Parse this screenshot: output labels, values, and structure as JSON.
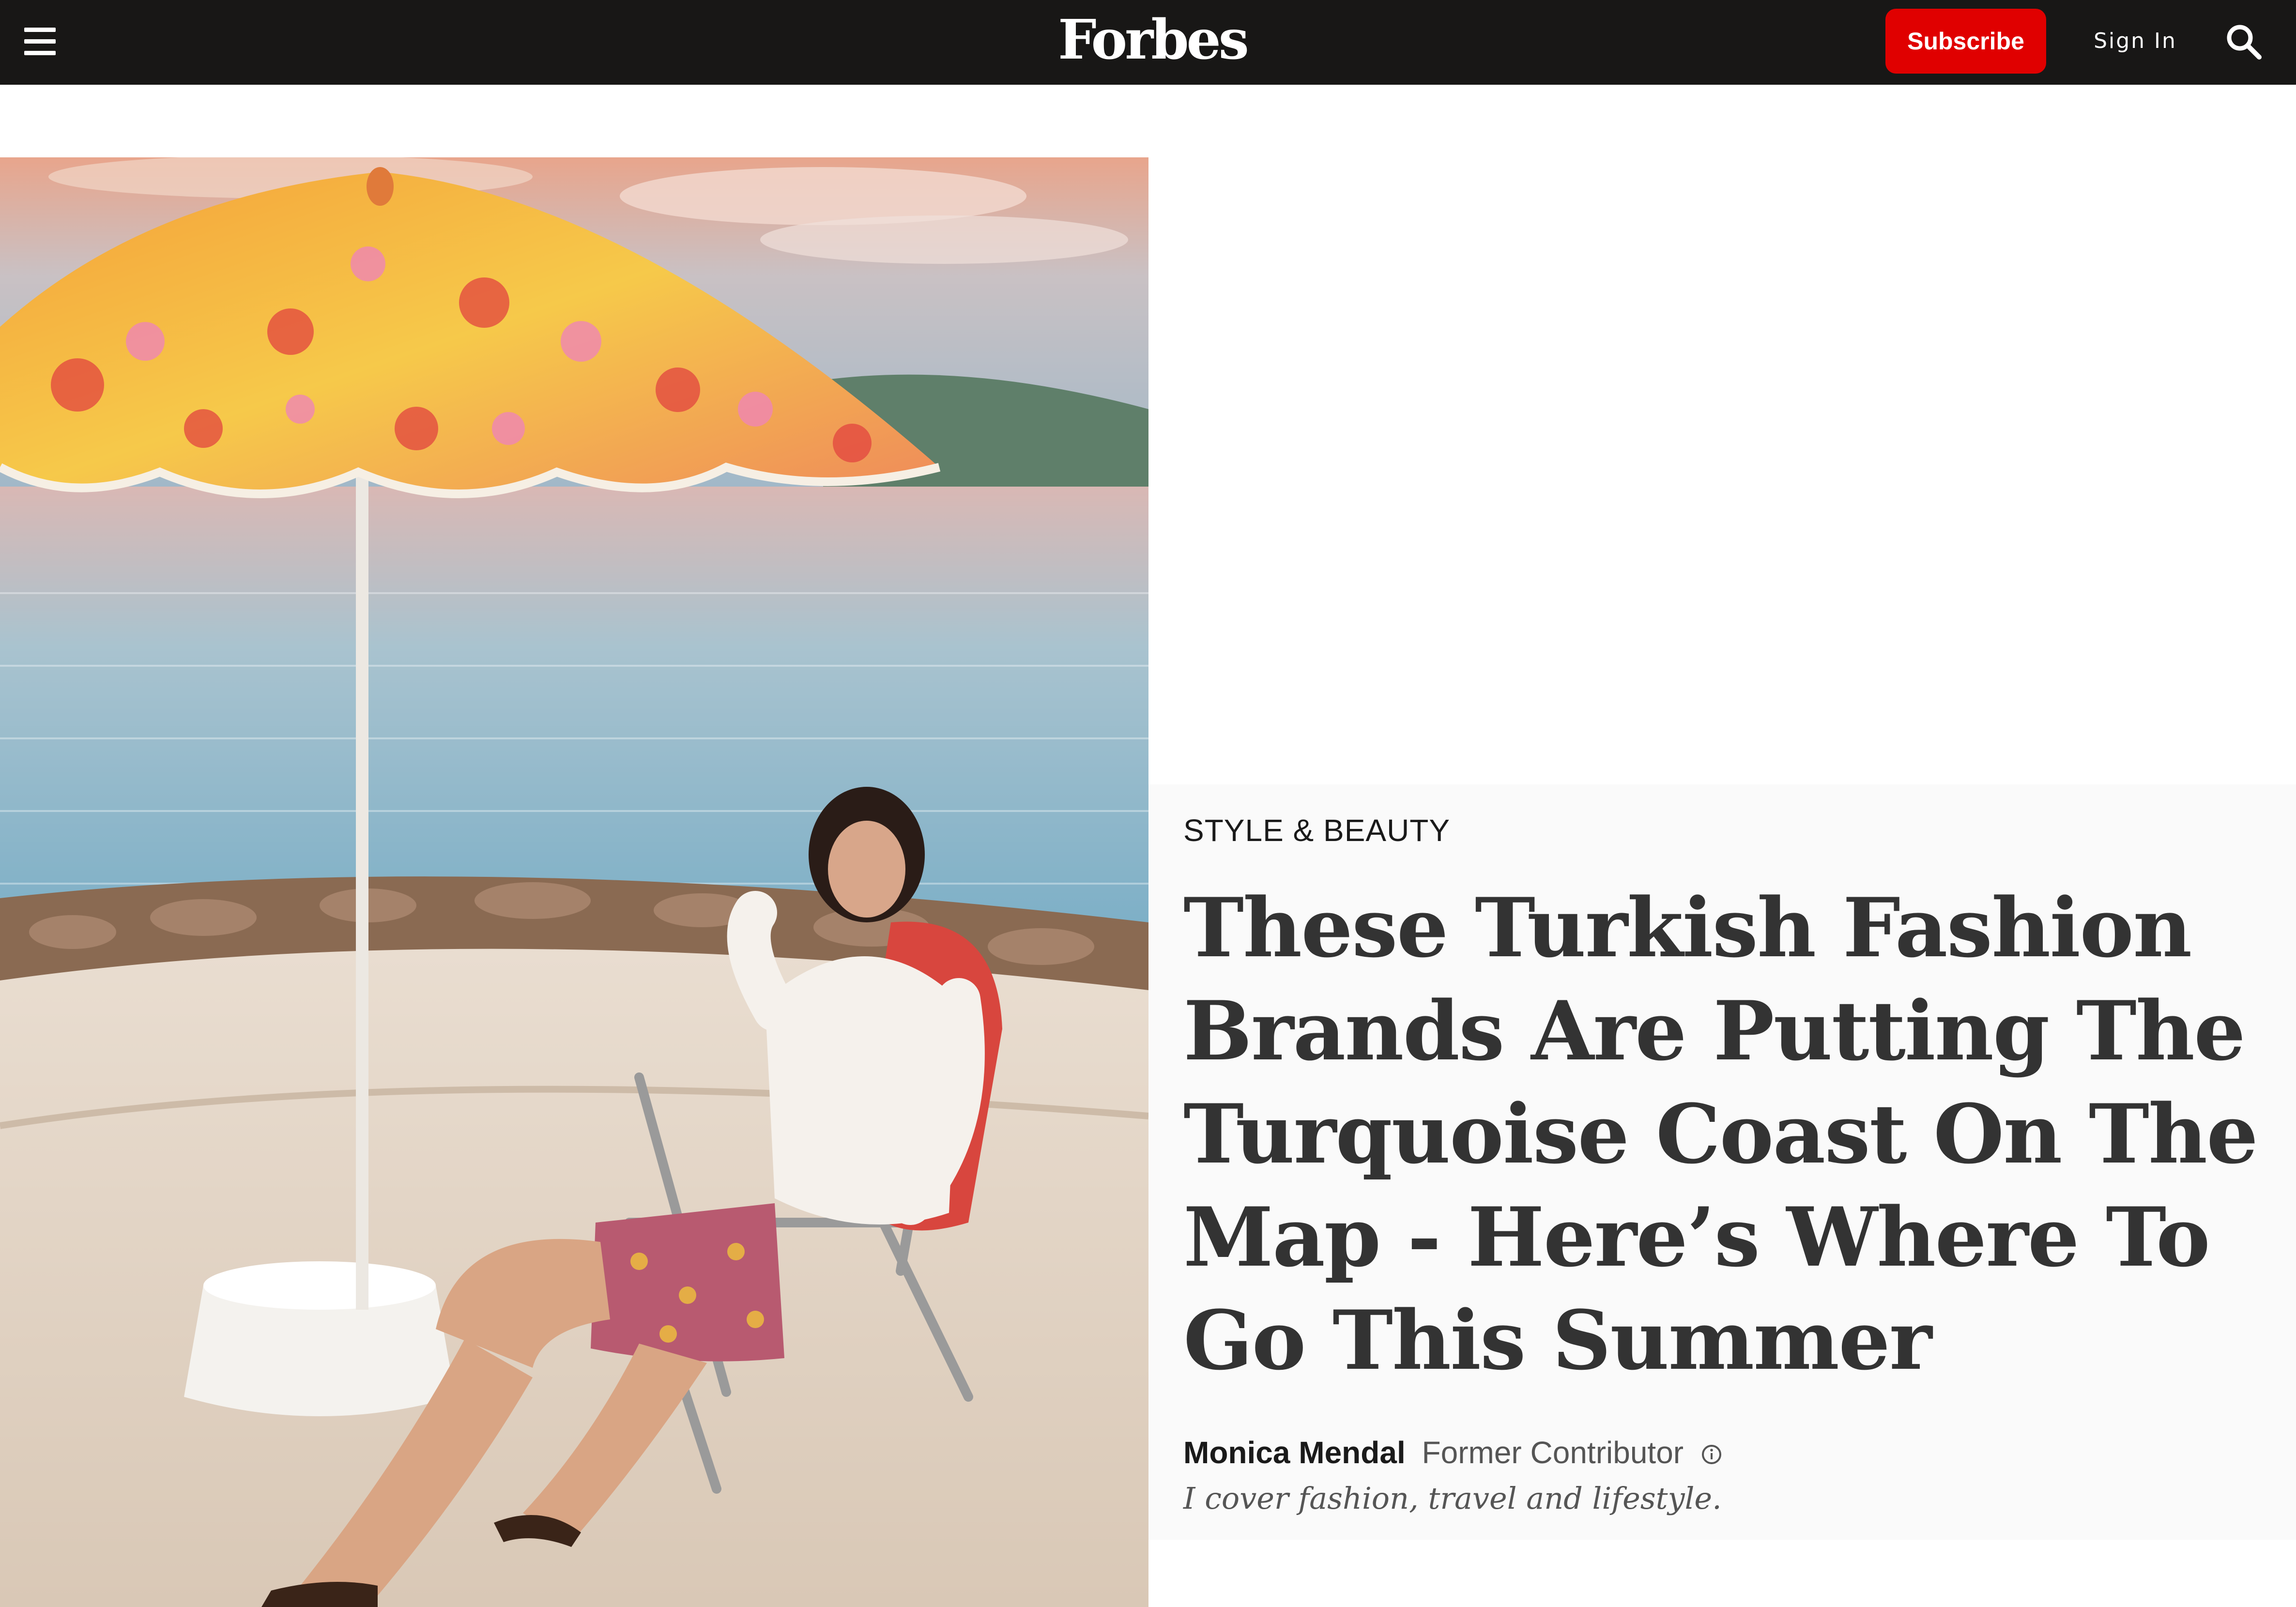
{
  "header": {
    "logo_text": "Forbes",
    "subscribe_label": "Subscribe",
    "signin_label": "Sign In",
    "icons": {
      "menu": "hamburger-menu-icon",
      "search": "search-icon"
    },
    "colors": {
      "bar_background": "#181716",
      "subscribe_background": "#e00000"
    }
  },
  "article": {
    "category": "STYLE & BEAUTY",
    "headline": "These Turkish Fashion Brands Are Putting The Turquoise Coast On The Map - Here’s Where To Go This Summer",
    "author": {
      "name": "Monica Mendal",
      "role": "Former Contributor",
      "bio": "I cover fashion, travel and lifestyle.",
      "info_icon": "info-circle-icon"
    }
  }
}
